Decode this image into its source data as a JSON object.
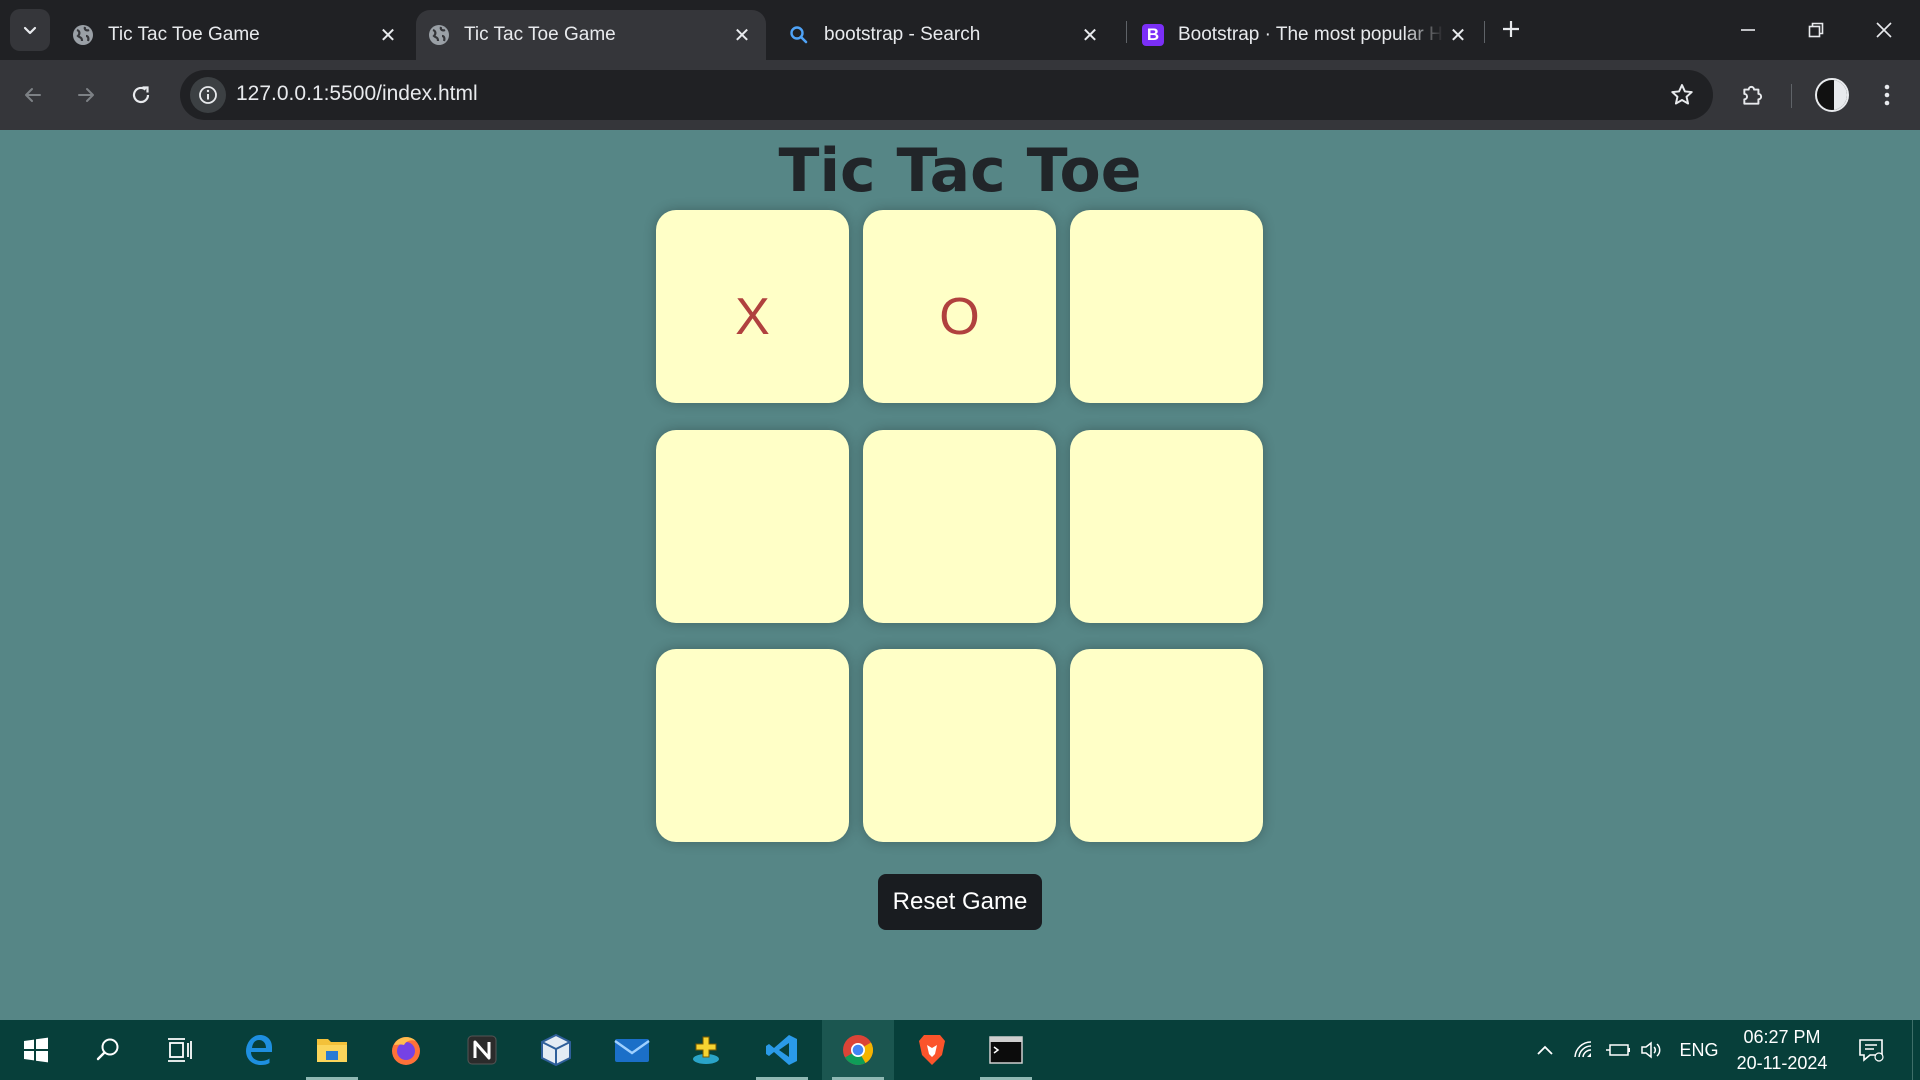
{
  "browser": {
    "tabs": [
      {
        "title": "Tic Tac Toe Game",
        "favicon": "globe-icon",
        "active": false
      },
      {
        "title": "Tic Tac Toe Game",
        "favicon": "globe-icon",
        "active": true
      },
      {
        "title": "bootstrap - Search",
        "favicon": "search-icon",
        "active": false
      },
      {
        "title": "Bootstrap · The most popular H",
        "favicon": "bootstrap-logo",
        "active": false
      }
    ],
    "bootstrap_logo_letter": "B",
    "url": "127.0.0.1:5500/index.html"
  },
  "game": {
    "title": "Tic Tac Toe",
    "cells": [
      "X",
      "O",
      "",
      "",
      "",
      "",
      "",
      "",
      ""
    ],
    "reset_label": "Reset Game",
    "colors": {
      "background": "#568686",
      "cell": "#ffffc7",
      "mark": "#b0413e",
      "button": "#191c20"
    }
  },
  "taskbar": {
    "apps": [
      "start-icon",
      "search-icon",
      "task-view-icon",
      "edge-icon",
      "file-explorer-icon",
      "firefox-icon",
      "notion-icon",
      "virtualbox-icon",
      "mail-icon",
      "game-launcher-icon",
      "vscode-icon",
      "chrome-icon",
      "brave-icon",
      "terminal-icon"
    ],
    "language": "ENG",
    "time": "06:27 PM",
    "date": "20-11-2024"
  }
}
